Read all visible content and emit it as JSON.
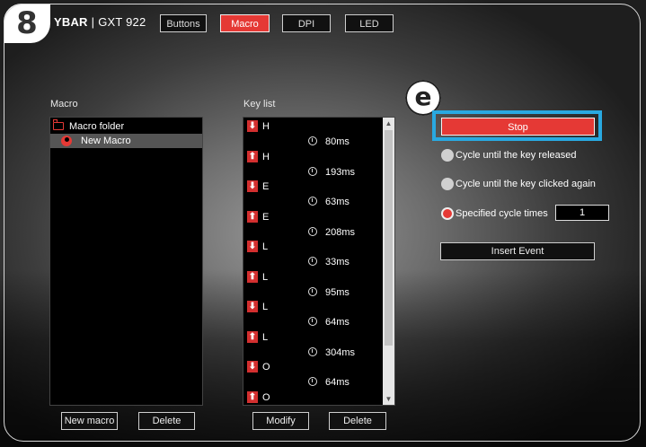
{
  "step_badge": "8",
  "callout_letter": "e",
  "header": {
    "brand": "YBAR",
    "separator": "|",
    "model": "GXT 922",
    "tabs": [
      {
        "label": "Buttons",
        "active": false
      },
      {
        "label": "Macro",
        "active": true
      },
      {
        "label": "DPI",
        "active": false
      },
      {
        "label": "LED",
        "active": false
      }
    ]
  },
  "macro_panel": {
    "title": "Macro",
    "folder_label": "Macro folder",
    "macro_label": "New Macro",
    "new_button": "New macro",
    "delete_button": "Delete"
  },
  "keylist_panel": {
    "title": "Key list",
    "events": [
      {
        "dir": "down",
        "key": "H",
        "delay": "80ms"
      },
      {
        "dir": "up",
        "key": "H",
        "delay": "193ms"
      },
      {
        "dir": "down",
        "key": "E",
        "delay": "63ms"
      },
      {
        "dir": "up",
        "key": "E",
        "delay": "208ms"
      },
      {
        "dir": "down",
        "key": "L",
        "delay": "33ms"
      },
      {
        "dir": "up",
        "key": "L",
        "delay": "95ms"
      },
      {
        "dir": "down",
        "key": "L",
        "delay": "64ms"
      },
      {
        "dir": "up",
        "key": "L",
        "delay": "304ms"
      },
      {
        "dir": "down",
        "key": "O",
        "delay": "64ms"
      },
      {
        "dir": "up",
        "key": "O",
        "delay": ""
      }
    ],
    "modify_button": "Modify",
    "delete_button": "Delete"
  },
  "options": {
    "stop_button": "Stop",
    "cycle_released": "Cycle until the key released",
    "cycle_clicked": "Cycle until the key clicked again",
    "specified_times": "Specified cycle times",
    "cycle_value": "1",
    "selected_option": "specified_times",
    "insert_event": "Insert Event"
  },
  "colors": {
    "accent_red": "#e53935",
    "highlight_blue": "#29a9e1"
  }
}
